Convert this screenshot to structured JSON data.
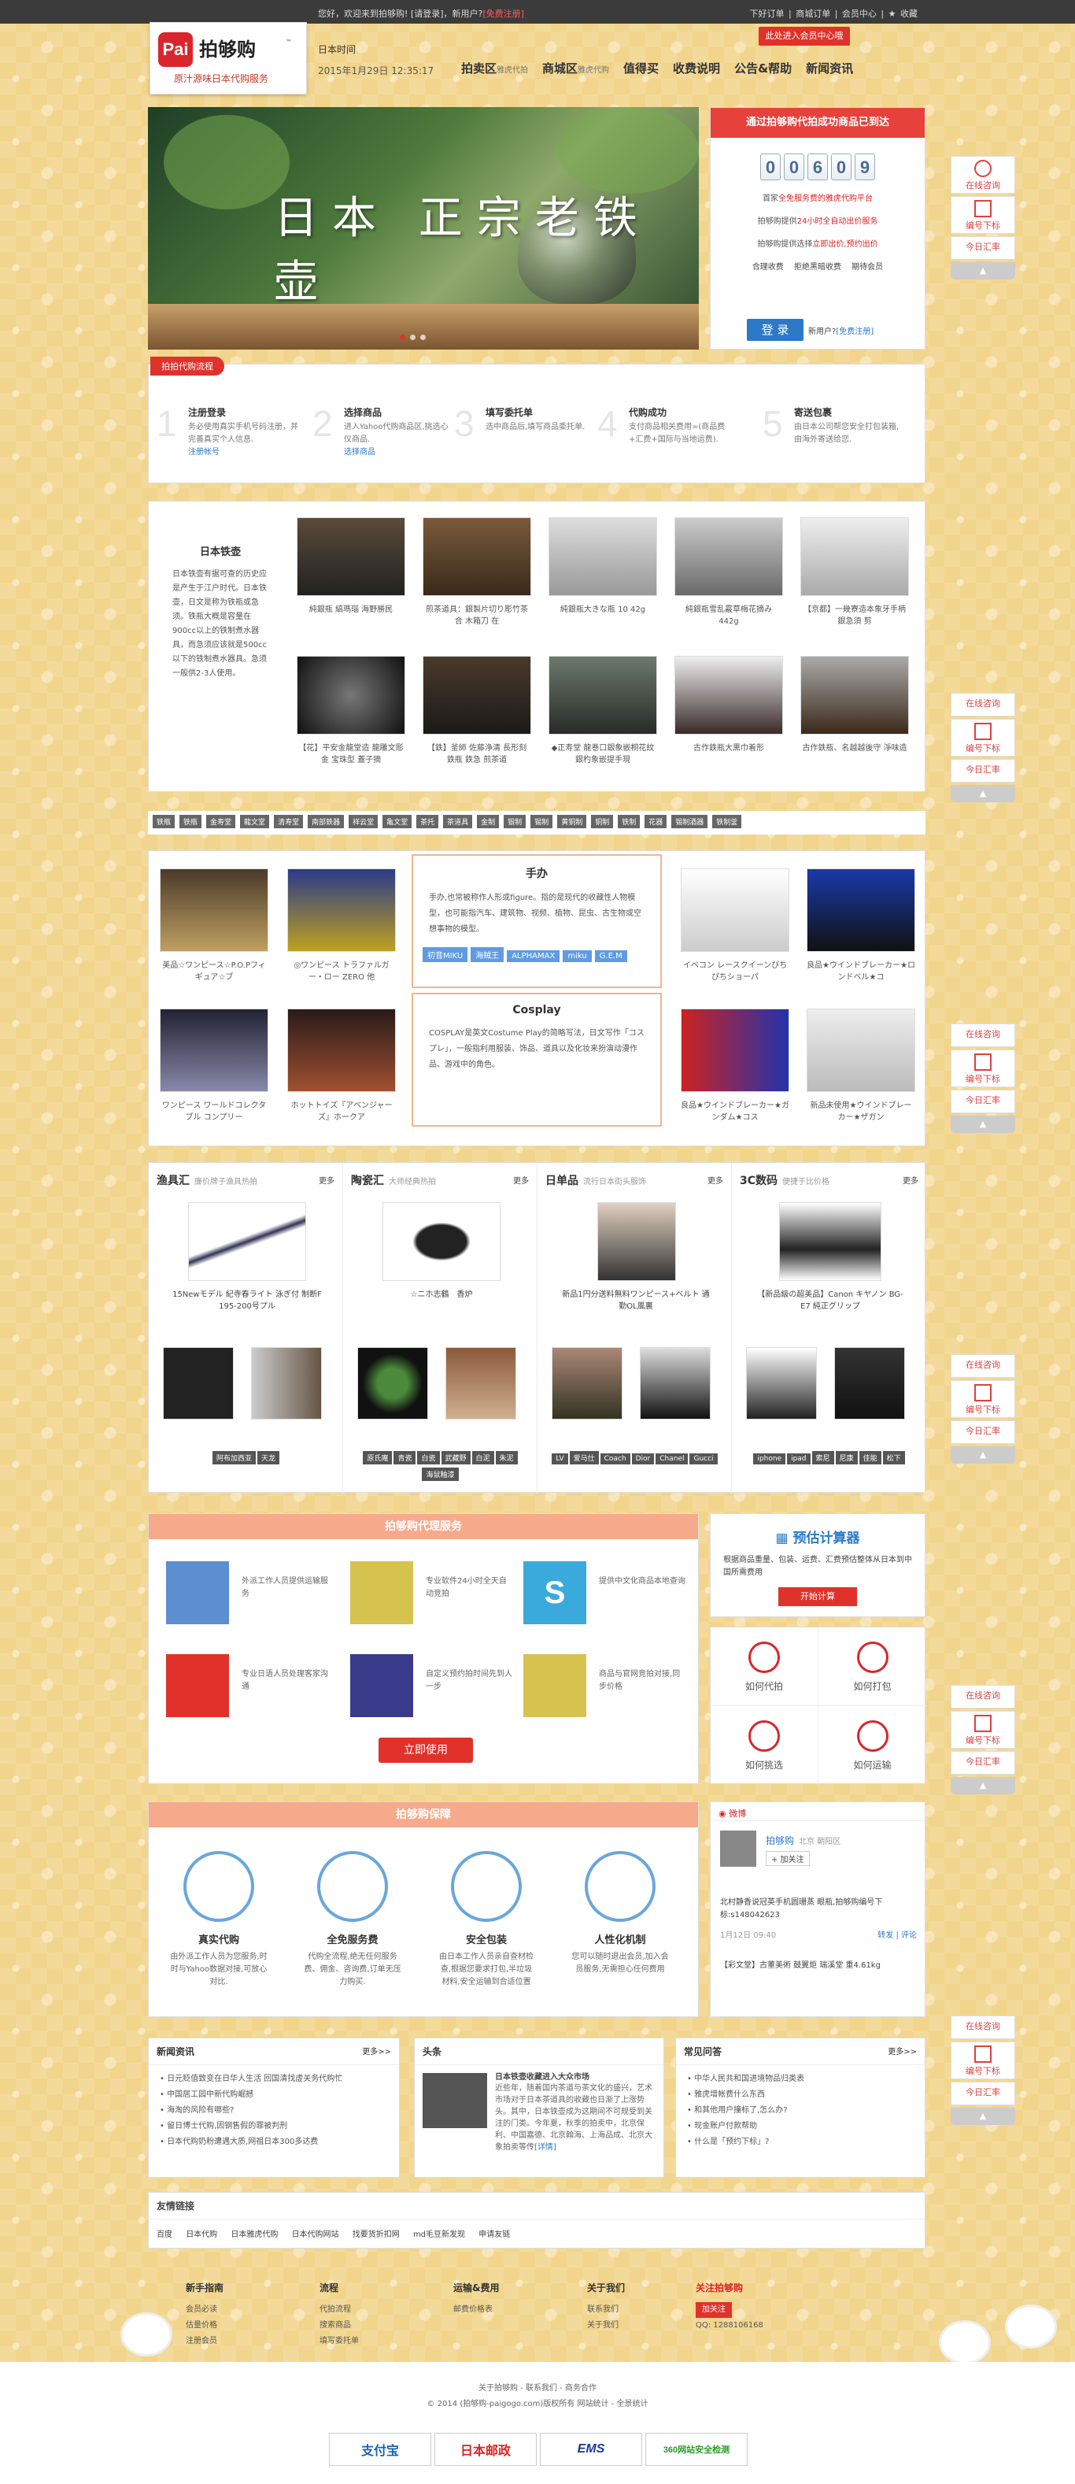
{
  "topbar": {
    "greet": "您好，欢迎来到拍够购! [请登录]，新用户?",
    "register": "[免费注册]",
    "links": "下好订单 | 商城订单 | 会员中心 | ★ 收藏"
  },
  "logo": {
    "badge": "Pai",
    "name": "拍够购",
    "tm": "™",
    "slogan": "原汁源味日本代购服务"
  },
  "time": {
    "label": "日本时间",
    "value": "2015年1月29日 12:35:17"
  },
  "nav": [
    {
      "label": "拍卖区",
      "sub": "雅虎代拍"
    },
    {
      "label": "商城区",
      "sub": "雅虎代购"
    },
    {
      "label": "值得买",
      "sub": ""
    },
    {
      "label": "收费说明",
      "sub": ""
    },
    {
      "label": "公告&帮助",
      "sub": ""
    },
    {
      "label": "新闻资讯",
      "sub": ""
    }
  ],
  "join_button": "此处进入会员中心哦",
  "banner": {
    "title": "日本 正宗老铁壶"
  },
  "stats": {
    "header": "通过拍够购代拍成功商品已到达",
    "digits": [
      "0",
      "0",
      "6",
      "0",
      "9"
    ],
    "line1a": "首家",
    "line1b": "全免服务费的雅虎代购平台",
    "line2a": "拍够购提供",
    "line2b": "24小时全自动出价服务",
    "line3a": "拍够购提供选择",
    "line3b": "立即出价,预约出价",
    "features": "合理收费 拒绝黑暗收费 期待会员",
    "login": "登 录",
    "newuser": "新用户?",
    "register": "[免费注册]"
  },
  "side": {
    "consult": "在线咨询",
    "number": "编号下标",
    "rate": "今日汇率"
  },
  "steps": {
    "tag": "拍拍代购流程",
    "items": [
      {
        "n": "1",
        "t": "注册登录",
        "d": "务必使用真实手机号码注册，并完善真实个人信息.",
        "link": "注册帐号"
      },
      {
        "n": "2",
        "t": "选择商品",
        "d": "进入Yahoo代购商品区,挑选心仪商品.",
        "link": "选择商品"
      },
      {
        "n": "3",
        "t": "填写委托单",
        "d": "选中商品后,填写商品委托单.",
        "link": ""
      },
      {
        "n": "4",
        "t": "代购成功",
        "d": "支付商品相关费用=(商品费+汇费+国际与当地运费).",
        "link": ""
      },
      {
        "n": "5",
        "t": "寄送包裹",
        "d": "由日本公司帮您安全打包装箱,由海外寄送给您.",
        "link": ""
      }
    ]
  },
  "tea": {
    "title": "日本铁壶",
    "desc": "日本铁壶有据可查的历史应是产生于江户时代。日本铁壶，日文是称为铁瓶或急须。铁瓶大概是容量在900cc以上的铁制煮水器具，而急须应该就是500cc以下的铁制煮水器具。急须一般供2-3人使用。",
    "products": [
      "純銀瓶 縞瑪瑙 海野勝民",
      "煎茶道具：銀製片切り彫竹茶合 木箱刀 在",
      "純銀瓶大きな瓶 10 42g",
      "純銀瓶雪乱霰草梅花摘み 442g",
      "【京都】一幾寮造本象牙手柄銀急須 剪",
      "【花】平安金龍堂造 龍雕文彫金 宝珠型 蓋子摘",
      "【鉄】釜師 佐藤浄清 長形刻 鉄瓶 鉄急 煎茶道",
      "◆正寿堂 龍巻口銀象嵌桐花紋 銀杓象嵌提手現",
      "古作鉄瓶大黒巾着形",
      "古作鉄瓶、名越越後守 淨味造"
    ]
  },
  "tagrow": [
    "铁瓶",
    "铁瓶",
    "金寿堂",
    "龍文堂",
    "清寿堂",
    "南部鉄器",
    "祥云堂",
    "亀文堂",
    "茶托",
    "茶道具",
    "金制",
    "银制",
    "锡制",
    "黄铜制",
    "铜制",
    "铁制",
    "花器",
    "锡制酒器",
    "铁制釜"
  ],
  "anime": {
    "figure_title": "手办",
    "figure_desc": "手办,也常被称作人形或figure。指的是现代的收藏性人物模型，也可能指汽车、建筑物、视频、植物、昆虫、古生物或空想事物的模型。",
    "figure_tags": [
      "初音MIKU",
      "海贼王",
      "ALPHAMAX",
      "miku",
      "G.E.M"
    ],
    "cos_title": "Cosplay",
    "cos_desc": "COSPLAY是英文Costume Play的简略写法，日文写作「コスプレ」，一般指利用服装、饰品、道具以及化妆来扮演动漫作品、游戏中的角色。",
    "products": [
      "美品☆ワンピース☆P.O.Pフィギュア☆ブ",
      "◎ワンピース トラファルガー・ロー ZERO 他",
      "ワンピース ワールドコレクタブル コンプリー",
      "ホットトイズ『アベンジャーズ』ホークア",
      "イベコン レースクイーンぴちぴちショーパ",
      "良品★ウインドブレーカー★ロンドベル★コ",
      "良品★ウインドブレーカー★ガンダム★コス",
      "新品未使用★ウインドブレーカー★ザガン"
    ]
  },
  "cats": [
    {
      "title": "渔具汇",
      "sub": "廉价牌子渔具热拍",
      "more": "更多",
      "cap": "15Newモデル 紀寺春ライト 泳ぎ付 制断F 195-200号プル",
      "tags": [
        "阿布加西亚",
        "天龙"
      ]
    },
    {
      "title": "陶瓷汇",
      "sub": "大师经典热拍",
      "more": "更多",
      "cap": "☆ニホ志鶴　香炉",
      "tags": [
        "原氏庵",
        "青瓷",
        "白瓷",
        "武藏野",
        "白泥",
        "朱泥",
        "海鼠釉漆"
      ]
    },
    {
      "title": "日单品",
      "sub": "流行日本街头服饰",
      "more": "更多",
      "cap": "新品1円分送料無料ワンピース+ベルト 通勤OL風裏",
      "tags": [
        "LV",
        "爱马仕",
        "Coach",
        "Dior",
        "Chanel",
        "Gucci"
      ]
    },
    {
      "title": "3C数码",
      "sub": "便捷于比价格",
      "more": "更多",
      "cap": "【新品級の超美品】Canon キヤノン BG-E7 純正グリップ",
      "tags": [
        "iphone",
        "ipad",
        "索尼",
        "尼康",
        "佳能",
        "松下"
      ]
    }
  ],
  "svc": {
    "title": "拍够购代理服务",
    "items": [
      "外派工作人员提供运输服务",
      "专业软件24小时全天自动竞拍",
      "提供中文化商品本地查询",
      "专业日语人员处理客家沟通",
      "自定义预约拍时间先到人一步",
      "商品与官网竞拍对接,同步价格"
    ],
    "button": "立即使用"
  },
  "estimate": {
    "title": "预估计算器",
    "desc": "根据商品重量、包装、运费、汇费预估整体从日本到中国所需费用",
    "button": "开始计算"
  },
  "help": [
    "如何代拍",
    "如何打包",
    "如何挑选",
    "如何运输"
  ],
  "guard": {
    "title": "拍够购保障",
    "items": [
      {
        "t": "真实代购",
        "d": "由外派工作人员为您服务,时时与Yahoo数据对接,可放心对比."
      },
      {
        "t": "全免服务费",
        "d": "代购全流程,绝无任何服务费、佣金、咨询费,订单无压力购买."
      },
      {
        "t": "安全包装",
        "d": "由日本工作人员亲自查材检查,根据您要求打包,半垃圾材料,安全运输到合适位置"
      },
      {
        "t": "人性化机制",
        "d": "您可以随时退出会员,加入会员服务,无需担心任何费用"
      }
    ]
  },
  "weibo": {
    "header": "微博",
    "name": "拍够购",
    "loc": "北京 朝阳区",
    "follow": "+ 加关注",
    "post": "北村静香说冠英手机圆珊蒸 眼瓶,拍够购编号下标:s148042623",
    "time": "1月12日 09:40",
    "actions": "转发 | 评论",
    "post2": "【彩文堂】古董美術 鼓翼炬 瑞溪堂 重4.61kg"
  },
  "news": {
    "title": "新闻资讯",
    "more": "更多>>",
    "items": [
      "日元贬值致变在日华人生活 回国清找虚关务代购忙",
      "中国居工园中新代购崛撼",
      "海淘的风险有哪些?",
      "留日博士代购,因钢售假的罪被判刑",
      "日本代购奶粉遭遇大质,网祖日本300多达费"
    ]
  },
  "headline": {
    "title": "头条",
    "article": "日本铁壶收藏进入大众市场",
    "desc": "近些年，随着国内茶道与茶文化的盛兴，艺术市场对于日本茶道具的收藏也日渐了上涨势头。其中，日本铁壶成为这期间不可规受到关注的门类。今年夏，秋季的拍卖中，北京保利、中国嘉德、北京翰海、上海品成、北京大象拍卖等传",
    "link": "[详情]"
  },
  "faq": {
    "title": "常见问答",
    "more": "更多>>",
    "items": [
      "中华人民共和国进境物品归类表",
      "雅虎增帐费什么东西",
      "和其他用户撞标了,怎么办?",
      "现金账户付款帮助",
      "什么是「预约下标」?"
    ]
  },
  "friends": {
    "title": "友情链接",
    "links": [
      "百度",
      "日本代购",
      "日本雅虎代购",
      "日本代购网站",
      "找要货折扣网",
      "md毛豆新发现",
      "申请友链"
    ]
  },
  "footnav": [
    {
      "h": "新手指南",
      "items": [
        "会员必读",
        "估量价格",
        "注册会员"
      ]
    },
    {
      "h": "流程",
      "items": [
        "代拍流程",
        "搜索商品",
        "填写委托单"
      ]
    },
    {
      "h": "运输&费用",
      "items": [
        "邮费价格表"
      ]
    },
    {
      "h": "关于我们",
      "items": [
        "联系我们",
        "关于我们"
      ]
    },
    {
      "h": "关注拍够购",
      "items": [
        "加关注",
        "QQ: 1288106168"
      ]
    }
  ],
  "footer": {
    "l1": "关于拍够购 - 联系我们 - 商务合作",
    "l2": "© 2014 (拍够购-paigogo.com)版权所有 网站统计 - 全景统计",
    "logos": [
      "支付宝",
      "日本邮政",
      "EMS",
      "360网站安全检测"
    ]
  }
}
